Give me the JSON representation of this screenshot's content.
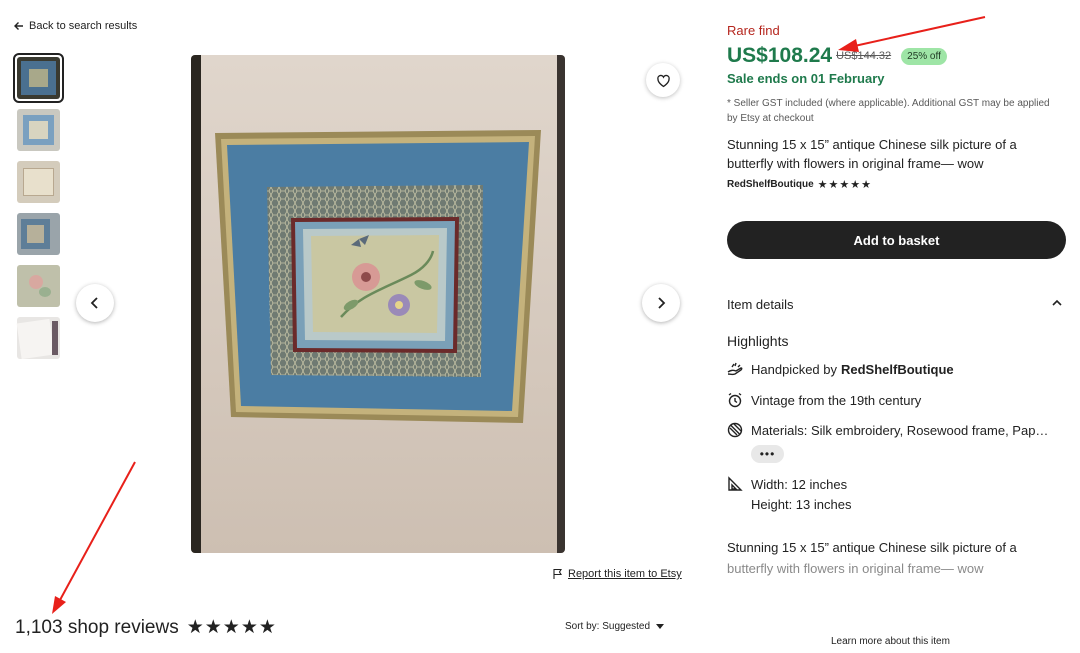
{
  "nav": {
    "back_label": "Back to search results"
  },
  "gallery": {
    "thumbnail_count": 6,
    "selected_index": 0
  },
  "actions": {
    "report_label": "Report this item to Etsy"
  },
  "reviews": {
    "title": "1,103 shop reviews",
    "rating_stars": "★★★★★",
    "sort_label": "Sort by: Suggested"
  },
  "listing": {
    "badge": "Rare find",
    "price": "US$108.24",
    "original_price": "US$144.32",
    "discount": "25% off",
    "sale_end": "Sale ends on 01 February",
    "gst_note": "* Seller GST included (where applicable). Additional GST may be applied by Etsy at checkout",
    "title": "Stunning 15 x 15” antique Chinese silk picture of a butterfly with flowers in original frame— wow",
    "seller": "RedShelfBoutique",
    "seller_stars": "★★★★★",
    "add_to_basket": "Add to basket"
  },
  "details": {
    "section_label": "Item details",
    "highlights_label": "Highlights",
    "handpicked_prefix": "Handpicked by",
    "handpicked_seller": "RedShelfBoutique",
    "vintage": "Vintage from the 19th century",
    "materials": "Materials: Silk embroidery, Rosewood frame, Pap…",
    "more_label": "•••",
    "width": "Width: 12 inches",
    "height": "Height: 13 inches",
    "description_line1": "Stunning 15 x 15” antique Chinese silk picture of a",
    "description_line2": "butterfly with flowers in original frame— wow",
    "learn_more": "Learn more about this item"
  },
  "colors": {
    "price_green": "#1f7a4c",
    "rare_red": "#b5261e",
    "discount_pill": "#9ee5a6",
    "button_dark": "#222222",
    "annotation_arrow": "#e8201a"
  },
  "icons": [
    "arrow-left-icon",
    "heart-icon",
    "chevron-left-icon",
    "chevron-right-icon",
    "flag-icon",
    "chevron-up-icon",
    "hand-icon",
    "clock-icon",
    "materials-icon",
    "ruler-icon",
    "sort-caret-icon"
  ]
}
